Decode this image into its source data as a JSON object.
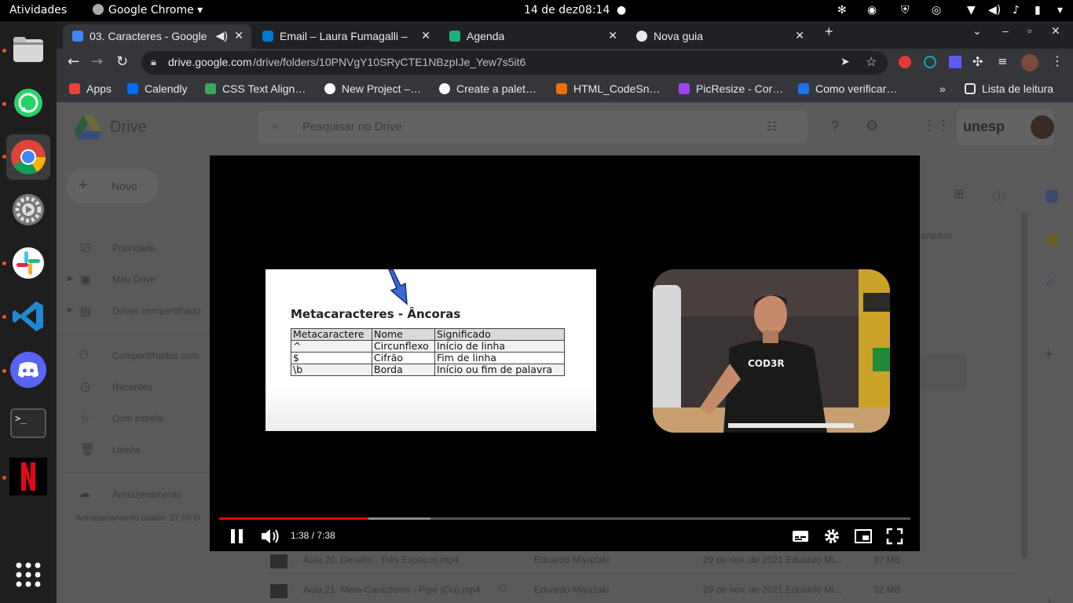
{
  "system": {
    "activities": "Atividades",
    "app_name": "Google Chrome",
    "date": "14 de dez",
    "time": "08:14"
  },
  "tabs": [
    {
      "title": "03. Caracteres - Google",
      "color": "#4285f4"
    },
    {
      "title": "Email – Laura Fumagalli –",
      "color": "#0078d4"
    },
    {
      "title": "Agenda",
      "color": "#20b07a"
    },
    {
      "title": "Nova guia",
      "color": "#e8eaed"
    }
  ],
  "address": {
    "domain": "drive.google.com",
    "path": "/drive/folders/10PNVgY10SRyCTE1NBzpIJe_Yew7s5it6"
  },
  "bookmarks": [
    {
      "label": "Apps",
      "color": "#ea4335"
    },
    {
      "label": "Calendly",
      "color": "#006bff"
    },
    {
      "label": "CSS Text Align…",
      "color": "#3ba55c"
    },
    {
      "label": "New Project –…",
      "color": "#ffffff"
    },
    {
      "label": "Create a palet…",
      "color": "#ffffff"
    },
    {
      "label": "HTML_CodeSn…",
      "color": "#e8710a"
    },
    {
      "label": "PicResize - Cor…",
      "color": "#a142f4"
    },
    {
      "label": "Como verificar…",
      "color": "#1a73e8"
    }
  ],
  "reading_list": "Lista de leitura",
  "drive": {
    "title": "Drive",
    "search_placeholder": "Pesquisar no Drive",
    "brand": "unesp",
    "new_button": "Novo",
    "nav": [
      "Prioridade",
      "Meu Drive",
      "Drives compartilhado",
      "Compartilhados com",
      "Recentes",
      "Com estrela",
      "Lixeira"
    ],
    "storage_label": "Armazenamento",
    "storage_used": "Armazenamento usado: 37,09 G",
    "column_hint": "arquivo",
    "files": [
      {
        "name": "Aula 20. Desafio - Três Espaços.mp4",
        "owner": "Eduardo Miyazaki",
        "date": "29 de nov. de 2021 Eduardo Mi...",
        "size": "3? MB"
      },
      {
        "name": "Aula 21. Meta-Caracteres - Pipe (Ou).mp4",
        "owner": "Eduardo Miyazaki",
        "date": "29 de nov. de 2021 Eduardo Mi...",
        "size": "32 MB"
      }
    ]
  },
  "video": {
    "slide_title": "Metacaracteres - Âncoras",
    "table_headers": [
      "Metacaractere",
      "Nome",
      "Significado"
    ],
    "table_rows": [
      [
        "^",
        "Circunflexo",
        "Início de linha"
      ],
      [
        "$",
        "Cifrão",
        "Fim de linha"
      ],
      [
        "\\b",
        "Borda",
        "Início ou fim de palavra"
      ]
    ],
    "shirt_logo": "COD3R",
    "time_display": "1:38 / 7:38",
    "progress_fraction": 0.216,
    "buffered_fraction": 0.306,
    "progress_color": "#ff0000"
  }
}
